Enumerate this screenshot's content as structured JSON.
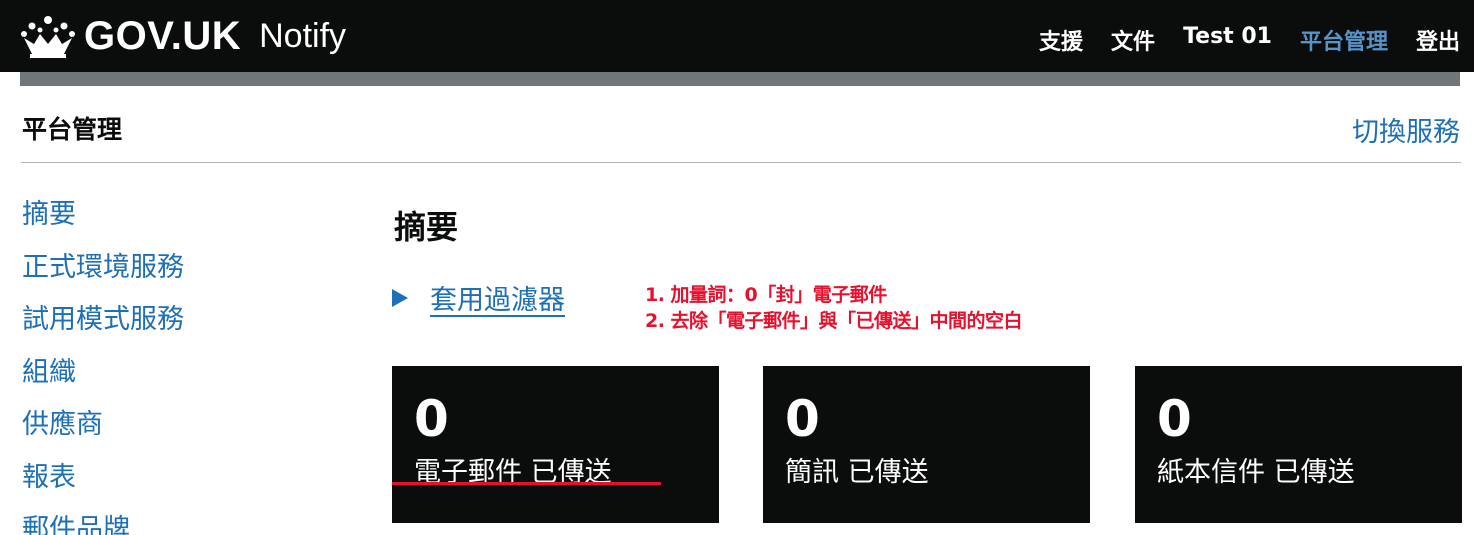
{
  "header": {
    "logo_text": "GOV.UK",
    "product": "Notify",
    "nav": [
      "支援",
      "文件",
      "Test 01",
      "平台管理",
      "登出"
    ],
    "active_nav": "平台管理",
    "colors": {
      "background": "#0b0c0c",
      "active": "#5694ca",
      "stripe": "#6f777b"
    }
  },
  "service": {
    "name": "平台管理",
    "switch_label": "切換服務"
  },
  "sidebar": {
    "items": [
      "摘要",
      "正式環境服務",
      "試用模式服務",
      "組織",
      "供應商",
      "報表",
      "郵件品牌"
    ]
  },
  "main": {
    "title": "摘要",
    "filter_label": "套用過濾器",
    "stats": [
      {
        "value": "0",
        "label": "電子郵件 已傳送"
      },
      {
        "value": "0",
        "label": "簡訊 已傳送"
      },
      {
        "value": "0",
        "label": "紙本信件 已傳送"
      }
    ]
  },
  "annotation": {
    "lines": [
      "1. 加量詞：0「封」電子郵件",
      "2. 去除「電子郵件」與「已傳送」中間的空白"
    ],
    "color": "#e8112d"
  },
  "colors": {
    "link": "#1d70b8",
    "text": "#0b0c0c"
  }
}
